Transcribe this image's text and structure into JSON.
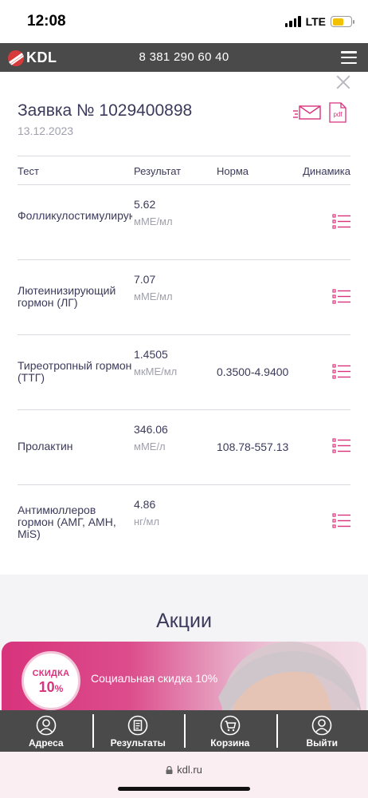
{
  "status_bar": {
    "time": "12:08",
    "network": "LTE",
    "battery_level": 0.62
  },
  "header": {
    "logo_text": "KDL",
    "phone": "8 381 290 60 40"
  },
  "order": {
    "title": "Заявка № 1029400898",
    "date": "13.12.2023",
    "pdf_label": "pdf"
  },
  "table": {
    "headers": {
      "test": "Тест",
      "result": "Результат",
      "norm": "Норма",
      "dynamics": "Динамика"
    },
    "rows": [
      {
        "name": "Фолликулостимулирующий гормон (ФСГ)",
        "value": "5.62",
        "unit": "мМЕ/мл",
        "norm": ""
      },
      {
        "name": "Лютеинизирующий гормон (ЛГ)",
        "value": "7.07",
        "unit": "мМЕ/мл",
        "norm": ""
      },
      {
        "name": "Тиреотропный гормон (ТТГ)",
        "value": "1.4505",
        "unit": "мкМЕ/мл",
        "norm": "0.3500-4.9400"
      },
      {
        "name": "Пролактин",
        "value": "346.06",
        "unit": "мМЕ/л",
        "norm": "108.78-557.13"
      },
      {
        "name": "Антимюллеров гормон (АМГ, АМН, MiS)",
        "value": "4.86",
        "unit": "нг/мл",
        "norm": ""
      }
    ]
  },
  "promo": {
    "title": "Акции",
    "badge_top": "СКИДКА",
    "badge_value": "10",
    "badge_percent": "%",
    "text": "Социальная скидка 10%"
  },
  "bottom_nav": {
    "items": [
      {
        "label": "Адреса",
        "icon": "address-person-icon"
      },
      {
        "label": "Результаты",
        "icon": "results-document-icon"
      },
      {
        "label": "Корзина",
        "icon": "cart-icon"
      },
      {
        "label": "Выйти",
        "icon": "logout-person-icon"
      }
    ]
  },
  "browser": {
    "url": "kdl.ru"
  },
  "colors": {
    "accent": "#d8337c",
    "header_bg": "#4a4a4a",
    "text": "#3b3a5c",
    "muted": "#a0a0ae"
  }
}
